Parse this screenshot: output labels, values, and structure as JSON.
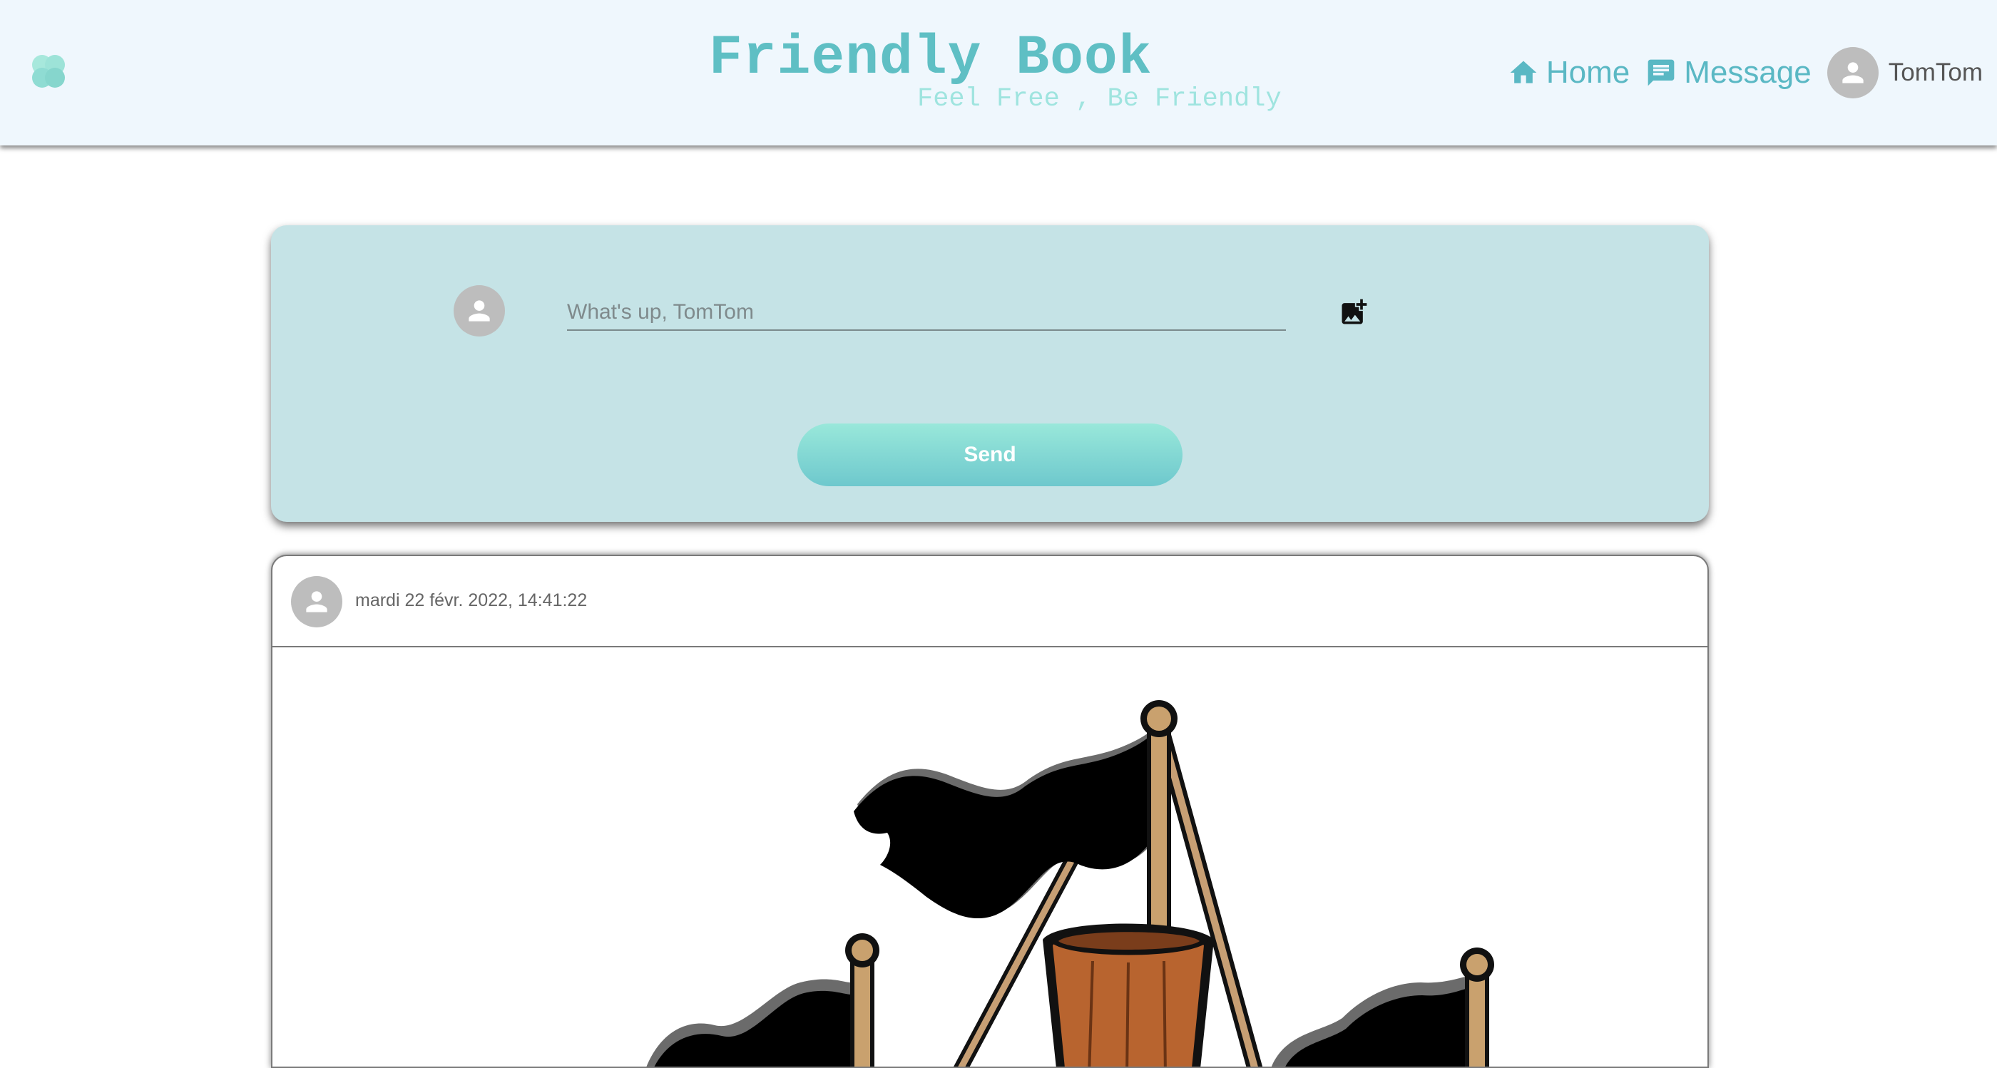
{
  "header": {
    "title": "Friendly Book",
    "subtitle": "Feel Free , Be Friendly",
    "nav": {
      "home_label": "Home",
      "message_label": "Message",
      "username": "TomTom"
    }
  },
  "composer": {
    "placeholder": "What's up, TomTom",
    "send_label": "Send"
  },
  "post": {
    "date": "mardi 22 févr. 2022, 14:41:22"
  },
  "colors": {
    "header_bg": "#eff7fd",
    "brand": "#5fbfc4",
    "subtitle": "#9fe4df",
    "composer_bg": "#c5e3e6",
    "avatar_bg": "#bdbdbd"
  },
  "icons": {
    "logo": "heart-logo-icon",
    "home": "home-icon",
    "message": "message-icon",
    "avatar": "person-icon",
    "add_image": "add-image-icon"
  }
}
